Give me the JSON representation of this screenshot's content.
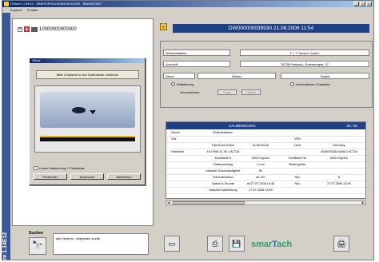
{
  "window": {
    "title": "OStore 1.14E12 - SBBR/SR/SU/4DAN/SH/CARS - BBA0000827",
    "menu": [
      "Explorer",
      "Fenster"
    ]
  },
  "sidebar": {
    "vertical_label": "OStore 1.14E12"
  },
  "tree": {
    "node_label": "10000000000000"
  },
  "dialog": {
    "title": "Ofizet",
    "message": "Bitte Chipkarte in den Kartenleser einführen",
    "checkbox_label": "Letzte Kalibrierung + Prüfabsatz",
    "buttons": [
      "Parameter",
      "Ausdrucen",
      "Abbrechen"
    ]
  },
  "header": {
    "id_text": "DW000000039530   21.08.2006 11:54"
  },
  "info": {
    "rows": [
      {
        "label": "Werkstattdaten",
        "value": "F + T Service GmbH"
      },
      {
        "label": "Anschrift",
        "value": "78736 Fertbach, Gutenbergstr. 37"
      }
    ],
    "name_label": "Name",
    "name_value1": "Walser",
    "name_value2": "Harald",
    "radio_calibration": "Kalibrierung",
    "radio_info": "Informationen Chipkarte",
    "info_label": "Informationen",
    "btn_copy": "Copy",
    "btn_delete": "Delete"
  },
  "calibration": {
    "title": "KALIBRIERUNG",
    "page": "30 / 30",
    "rows": [
      [
        "Grund",
        "Erstinstallation",
        "",
        "",
        ""
      ],
      [
        "VIN",
        "",
        "",
        "VRN",
        ""
      ],
      [
        "",
        "Fahrtenschreiber",
        "AC301404A",
        "Land",
        "Germany"
      ],
      [
        "Hersteller",
        "1617965.01.06.1 ACTIA",
        "",
        "",
        "4034000283.6486.2 ACTIA"
      ],
      [
        "",
        "Konstante K",
        "6000 imp/km",
        "Koeffizient W",
        "6000 imp/km"
      ],
      [
        "",
        "Reifenumfang",
        "1 mm",
        "Reifengröße",
        ""
      ],
      [
        "",
        "erlaubte Geschwindigkeit",
        "90",
        "",
        ""
      ],
      [
        "",
        "Kilometerstand",
        "alt 187",
        "Neu",
        "8"
      ],
      [
        "",
        "Datum & Stunde",
        "alt 27.07.2006 13:48",
        "Neu",
        "27.07.2006 13:59"
      ],
      [
        "",
        "Nächste Kalibrierung",
        "27.07.2006 13:59",
        "",
        ""
      ]
    ]
  },
  "search": {
    "label": "Suchen",
    "notes": "alle Karten\\n- chipkarten suche"
  },
  "logo": {
    "text_a": "smar",
    "text_j": "T",
    "text_b": "ach"
  },
  "colors": {
    "title_blue": "#0a246a",
    "header_blue": "#1f3f86",
    "sidebar_blue": "#39579a",
    "logo_green": "#27a06a"
  }
}
